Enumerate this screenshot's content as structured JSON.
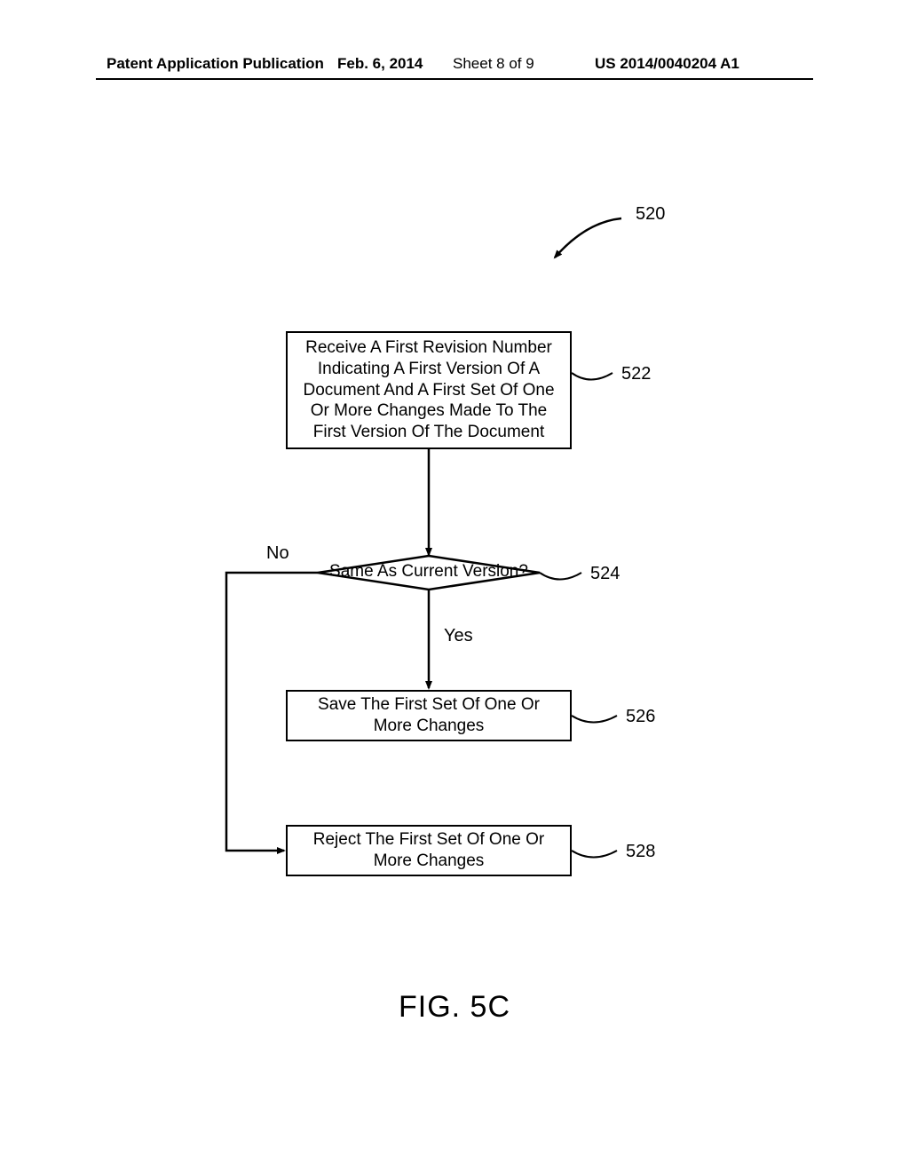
{
  "header": {
    "publication": "Patent Application Publication",
    "date": "Feb. 6, 2014",
    "sheet": "Sheet 8 of 9",
    "docno": "US 2014/0040204 A1"
  },
  "flowchart": {
    "fig_ref": "520",
    "step_receive": {
      "text": "Receive A First Revision Number Indicating A First Version Of A Document And A First Set Of One Or More Changes Made To The First Version Of The Document",
      "ref": "522"
    },
    "decision": {
      "text": "Same As Current Version?",
      "ref": "524",
      "no_label": "No",
      "yes_label": "Yes"
    },
    "step_save": {
      "text": "Save The First Set Of One Or More Changes",
      "ref": "526"
    },
    "step_reject": {
      "text": "Reject The First Set Of One Or More Changes",
      "ref": "528"
    }
  },
  "figure_caption": "FIG. 5C"
}
